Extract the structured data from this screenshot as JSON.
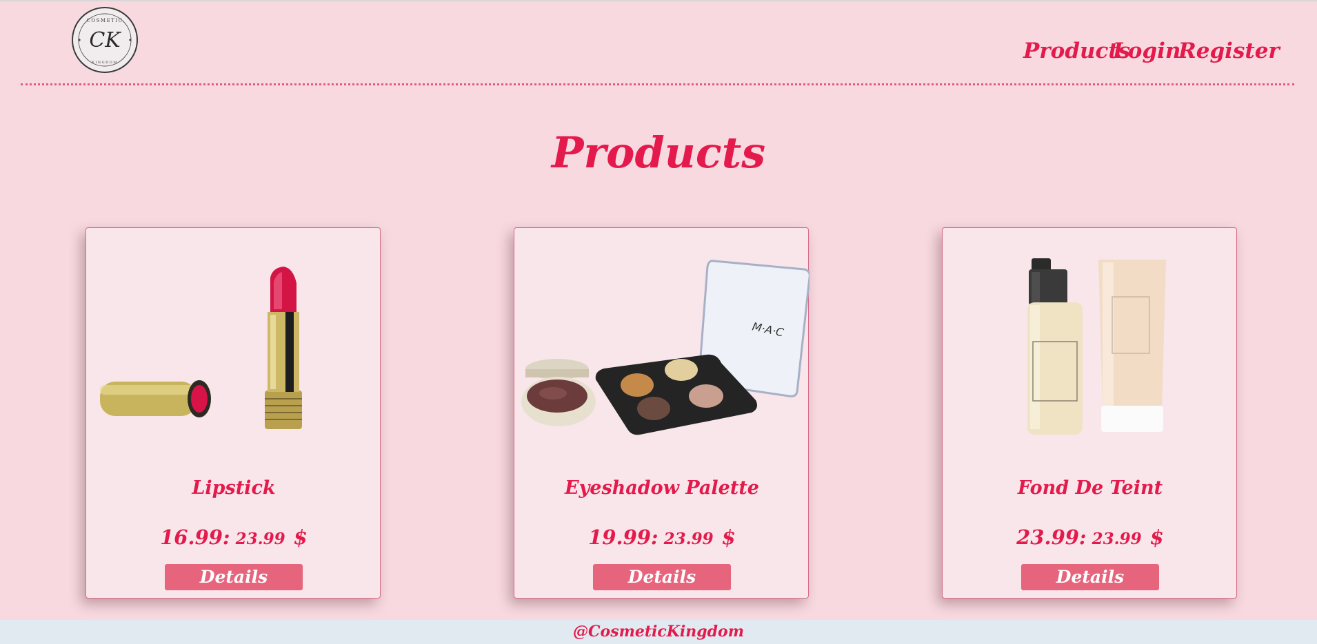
{
  "header": {
    "logo": {
      "text_top": "COSMETIC",
      "monogram": "CK",
      "text_bottom": "KINGDOM",
      "icon": "logo-emblem-icon"
    },
    "nav": {
      "products": "Products",
      "login": "Login",
      "register": "Register"
    }
  },
  "main": {
    "title": "Products",
    "products": [
      {
        "name": "Lipstick",
        "price": "16.99:",
        "old_price": "23.99",
        "currency": "$",
        "button": "Details",
        "image": "lipstick-image"
      },
      {
        "name": "Eyeshadow Palette",
        "price": "19.99:",
        "old_price": "23.99",
        "currency": "$",
        "button": "Details",
        "image": "eyeshadow-palette-image"
      },
      {
        "name": "Fond De Teint",
        "price": "23.99:",
        "old_price": "23.99",
        "currency": "$",
        "button": "Details",
        "image": "foundation-image"
      }
    ]
  },
  "footer": {
    "handle": "@CosmeticKingdom"
  },
  "colors": {
    "background": "#f7d9df",
    "accent": "#e31a4b",
    "button": "#e6657d",
    "card": "#f8e6ea",
    "footer": "#e1eaf1"
  }
}
